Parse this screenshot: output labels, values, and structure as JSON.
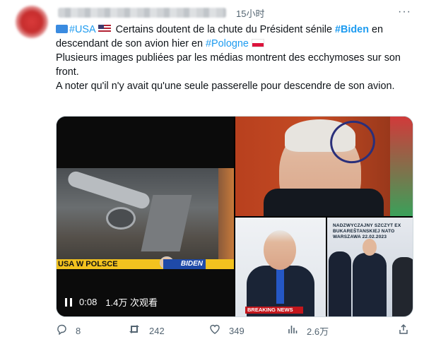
{
  "tweet": {
    "time": "15小时",
    "text": {
      "line1_hashtag_usa": "#USA",
      "line1_text": " Certains doutent de la chute du Président sénile ",
      "line1_hashtag_biden": "#Biden",
      "line1_tail": " en descendant de son avion hier en ",
      "line1_hashtag_pologne": "#Pologne",
      "paragraph2": "Plusieurs images publiées par les médias montrent des ecchymoses sur son front.",
      "paragraph3": "A noter qu'il n'y avait qu'une seule passerelle pour descendre de son avion."
    },
    "flags": [
      "blue-square",
      "us-flag",
      "poland-flag"
    ]
  },
  "media": {
    "video": {
      "banner_text": "USA W POLSCE",
      "banner_name": "BIDEN",
      "time": "0:08",
      "views": "1.4万 次观看"
    },
    "image2_caption": "BREAKING NEWS",
    "image3_caption": "NADZWYCZAJNY SZCZYT EX\nBUKAREŠTANSKIEJ NATO\nWARSZAWA 22.02.2023"
  },
  "actions": {
    "reply_count": "8",
    "retweet_count": "242",
    "like_count": "349",
    "views_count": "2.6万"
  },
  "colors": {
    "accent": "#1d9bf0",
    "text": "#0f1419",
    "muted": "#536471"
  }
}
